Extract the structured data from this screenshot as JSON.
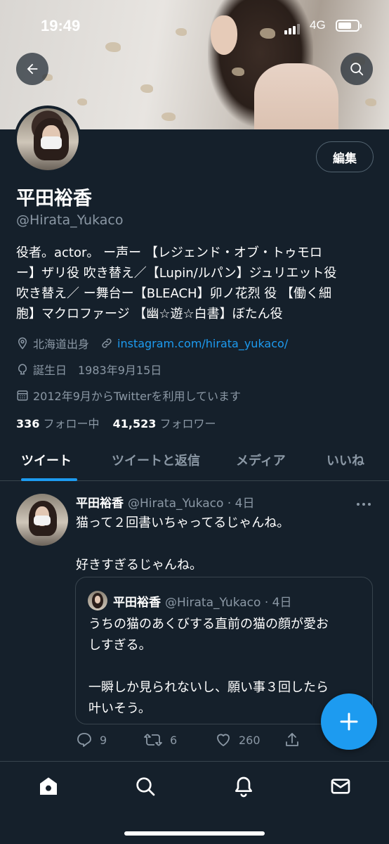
{
  "status_bar": {
    "time": "19:49",
    "network": "4G"
  },
  "profile": {
    "name": "平田裕香",
    "handle": "@Hirata_Yukaco",
    "edit_label": "編集",
    "bio_lines": [
      "役者。actor。 ー声ー 【レジェンド・オブ・トゥモロ",
      "ー】ザリ役 吹き替え／【Lupin/ルパン】ジュリエット役",
      "吹き替え／ ー舞台ー【BLEACH】卯ノ花烈 役 【働く細",
      "胞】マクロファージ 【幽☆遊☆白書】ぼたん役"
    ],
    "location": "北海道出身",
    "website": "instagram.com/hirata_yukaco/",
    "birthday": "誕生日　1983年9月15日",
    "joined": "2012年9月からTwitterを利用しています",
    "following_count": "336",
    "following_label": "フォロー中",
    "followers_count": "41,523",
    "followers_label": "フォロワー"
  },
  "tabs": [
    {
      "label": "ツイート",
      "active": true
    },
    {
      "label": "ツイートと返信",
      "active": false
    },
    {
      "label": "メディア",
      "active": false
    },
    {
      "label": "いいね",
      "active": false
    }
  ],
  "tweet": {
    "name": "平田裕香",
    "handle_time": "@Hirata_Yukaco · 4日",
    "text_line1": "猫って２回書いちゃってるじゃんね。",
    "text_line2": "好きすぎるじゃんね。",
    "quote": {
      "name": "平田裕香",
      "handle_time": "@Hirata_Yukaco · 4日",
      "line1": "うちの猫のあくびする直前の猫の顔が愛お",
      "line2": "しすぎる。",
      "line3": "一瞬しか見られないし、願い事３回したら",
      "line4": "叶いそう。"
    },
    "reply_count": "9",
    "retweet_count": "6",
    "like_count": "260"
  },
  "colors": {
    "background": "#15202b",
    "accent": "#1d9bf0",
    "muted": "#8b98a5",
    "border": "#38444d"
  },
  "icons": [
    "back-arrow-icon",
    "search-icon",
    "location-icon",
    "link-icon",
    "birthday-icon",
    "calendar-icon",
    "more-icon",
    "reply-icon",
    "retweet-icon",
    "like-icon",
    "share-icon",
    "compose-plus-icon",
    "home-icon",
    "nav-search-icon",
    "notifications-icon",
    "messages-icon"
  ]
}
